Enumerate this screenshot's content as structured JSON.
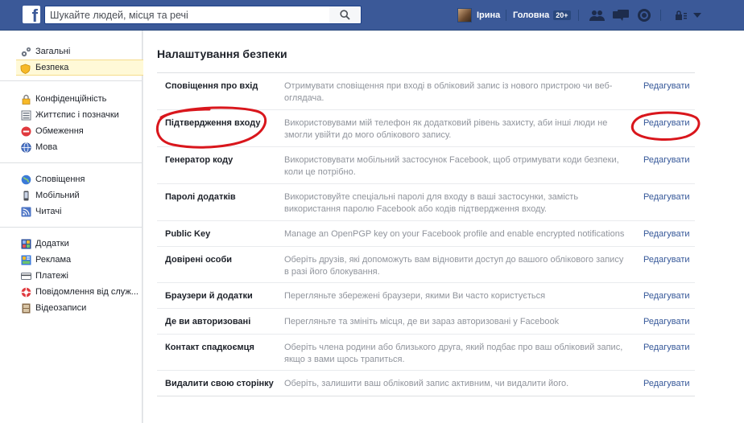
{
  "topbar": {
    "logo": "f",
    "search_placeholder": "Шукайте людей, місця та речі",
    "user_name": "Ірина",
    "home_label": "Головна",
    "home_badge": "20+",
    "icons": [
      "friends-icon",
      "messages-icon",
      "notifications-icon",
      "privacy-icon",
      "account-menu-icon"
    ]
  },
  "sidebar": {
    "groups": [
      {
        "items": [
          {
            "label": "Загальні",
            "icon": "gear-icon"
          },
          {
            "label": "Безпека",
            "icon": "shield-icon",
            "active": true
          }
        ]
      },
      {
        "items": [
          {
            "label": "Конфіденційність",
            "icon": "lock-icon"
          },
          {
            "label": "Життєпис і позначки",
            "icon": "timeline-icon"
          },
          {
            "label": "Обмеження",
            "icon": "block-icon"
          },
          {
            "label": "Мова",
            "icon": "globe-icon"
          }
        ]
      },
      {
        "items": [
          {
            "label": "Сповіщення",
            "icon": "globe-notifications-icon"
          },
          {
            "label": "Мобільний",
            "icon": "mobile-icon"
          },
          {
            "label": "Читачі",
            "icon": "rss-icon"
          }
        ]
      },
      {
        "items": [
          {
            "label": "Додатки",
            "icon": "apps-icon"
          },
          {
            "label": "Реклама",
            "icon": "ads-icon"
          },
          {
            "label": "Платежі",
            "icon": "payments-icon"
          },
          {
            "label": "Повідомлення від служ...",
            "icon": "support-icon"
          },
          {
            "label": "Відеозаписи",
            "icon": "video-icon"
          }
        ]
      }
    ]
  },
  "main": {
    "title": "Налаштування безпеки",
    "edit_label": "Редагувати",
    "rows": [
      {
        "name": "Сповіщення про вхід",
        "desc": "Отримувати сповіщення при вході в обліковий запис із нового пристрою чи веб-оглядача.",
        "edit": true
      },
      {
        "name": "Підтвердження входу",
        "desc": "Використовувами мій телефон як додатковий рівень захисту, аби інші люди не змогли увійти до мого облікового запису.",
        "edit": true
      },
      {
        "name": "Генератор коду",
        "desc": "Використовувати мобільний застосунок Facebook, щоб отримувати коди безпеки, коли це потрібно.",
        "edit": true
      },
      {
        "name": "Паролі додатків",
        "desc": "Використовуйте спеціальні паролі для входу в ваші застосунки, замість використання паролю Facebook або кодів підтвердження входу.",
        "edit": true
      },
      {
        "name": "Public Key",
        "desc": "Manage an OpenPGP key on your Facebook profile and enable encrypted notifications",
        "edit": true
      },
      {
        "name": "Довірені особи",
        "desc": "Оберіть друзів, які допоможуть вам відновити доступ до вашого облікового запису в разі його блокування.",
        "edit": true
      },
      {
        "name": "Браузери й додатки",
        "desc": "Перегляньте збережені браузери, якими Ви часто користується",
        "edit": true
      },
      {
        "name": "Де ви авторизовані",
        "desc": "Перегляньте та змініть місця, де ви зараз авторизовані у Facebook",
        "edit": true
      },
      {
        "name": "Контакт спадкоємця",
        "desc": "Оберіть члена родини або близького друга, який подбає про ваш обліковий запис, якщо з вами щось трапиться.",
        "edit": true
      },
      {
        "name": "Видалити свою сторінку",
        "desc": "Оберіть, залишити ваш обліковий запис активним, чи видалити його.",
        "edit": true
      }
    ]
  }
}
